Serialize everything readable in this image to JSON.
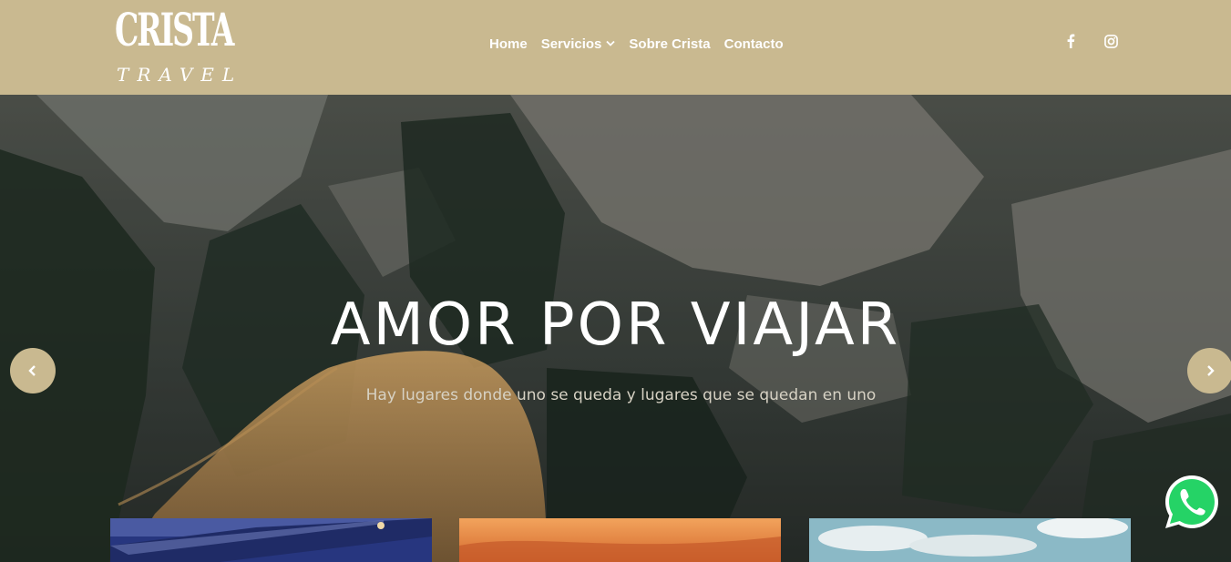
{
  "logo": {
    "main": "CRISTA",
    "sub": "TRAVEL"
  },
  "nav": {
    "items": [
      {
        "label": "Home"
      },
      {
        "label": "Servicios"
      },
      {
        "label": "Sobre Crista"
      },
      {
        "label": "Contacto"
      }
    ]
  },
  "social": {
    "icons": [
      "facebook-icon",
      "instagram-icon"
    ]
  },
  "hero": {
    "title": "AMOR POR VIAJAR",
    "subtitle": "Hay lugares donde uno se queda y lugares que se quedan en uno"
  },
  "colors": {
    "header": "#c9b990",
    "arrow": "#c9b990",
    "whatsapp": "#25d366"
  },
  "floating": {
    "icon": "whatsapp-icon"
  }
}
